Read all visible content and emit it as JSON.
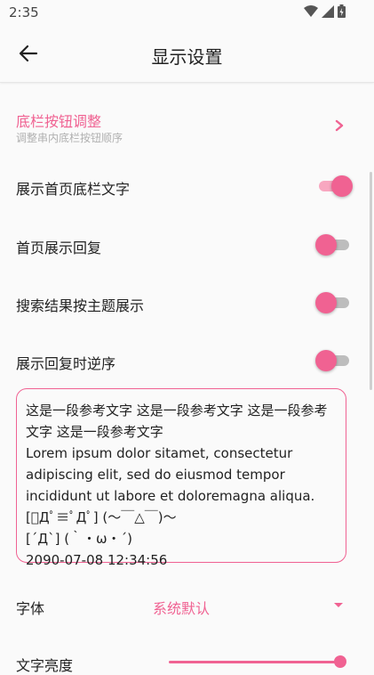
{
  "status": {
    "time": "2:35"
  },
  "appbar": {
    "title": "显示设置"
  },
  "items": {
    "tab_adjust": {
      "title": "底栏按钮调整",
      "subtitle": "调整串内底栏按钮顺序"
    },
    "show_tab_text": {
      "label": "展示首页底栏文字",
      "on": true
    },
    "home_show_reply": {
      "label": "首页展示回复",
      "on": false
    },
    "search_by_topic": {
      "label": "搜索结果按主题展示",
      "on": false
    },
    "reverse_reply": {
      "label": "展示回复时逆序",
      "on": false
    }
  },
  "preview": {
    "line1": "这是一段参考文字 这是一段参考文字 这是一段参考文字 这是一段参考文字",
    "line2": "Lorem ipsum dolor sitamet, consectetur adipiscing elit, sed do eiusmod tempor incididunt ut labore et doloremagna aliqua.",
    "line3": "[ﾟДﾟ≡ﾟДﾟ] (〜￣△￣)〜",
    "line4": "[´Д`] (｀・ω・´)",
    "line5": "2090-07-08 12:34:56"
  },
  "font": {
    "label": "字体",
    "value": "系统默认"
  },
  "brightness": {
    "label": "文字亮度",
    "value": 1.0
  },
  "colors": {
    "accent": "#f06292",
    "accent_light": "#f8a7c0"
  }
}
